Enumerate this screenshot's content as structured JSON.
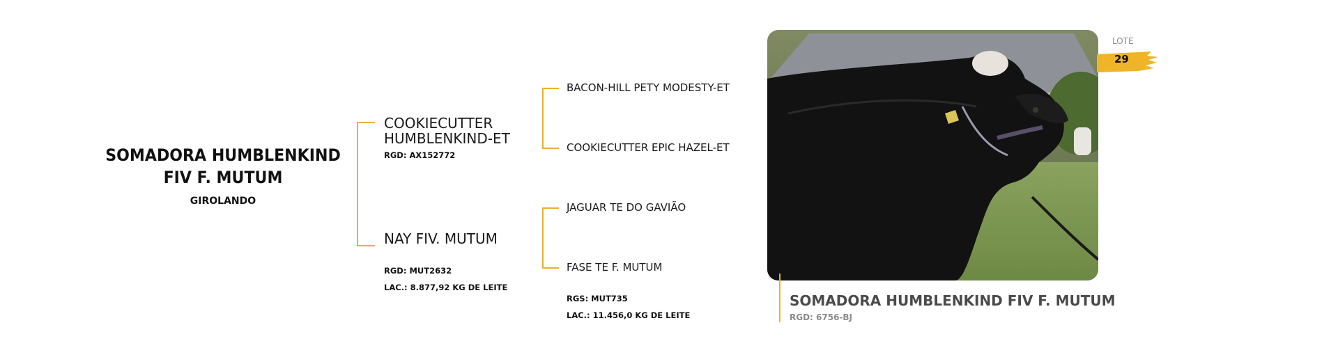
{
  "animal": {
    "name_line1": "SOMADORA HUMBLENKIND",
    "name_line2": "FIV F. MUTUM",
    "breed": "GIROLANDO"
  },
  "sire": {
    "name_line1": "COOKIECUTTER",
    "name_line2": "HUMBLENKIND-ET",
    "rgd": "RGD: AX152772"
  },
  "dam": {
    "name": "NAY FIV. MUTUM",
    "rgd": "RGD: MUT2632",
    "lac": "LAC.: 8.877,92 KG DE LEITE"
  },
  "sire_sire": "BACON-HILL PETY MODESTY-ET",
  "sire_dam": "COOKIECUTTER EPIC HAZEL-ET",
  "dam_sire": "JAGUAR TE DO GAVIÃO",
  "dam_dam": {
    "name": "FASE TE F. MUTUM",
    "rgs": "RGS: MUT735",
    "lac": "LAC.: 11.456,0 KG DE LEITE"
  },
  "lote": {
    "label": "LOTE",
    "number": "29"
  },
  "caption": {
    "name": "SOMADORA HUMBLENKIND FIV F. MUTUM",
    "rgd": "RGD: 6756-BJ"
  },
  "colors": {
    "accent": "#e9b22e",
    "text": "#1a1a1a",
    "muted": "#8a8a8a"
  }
}
